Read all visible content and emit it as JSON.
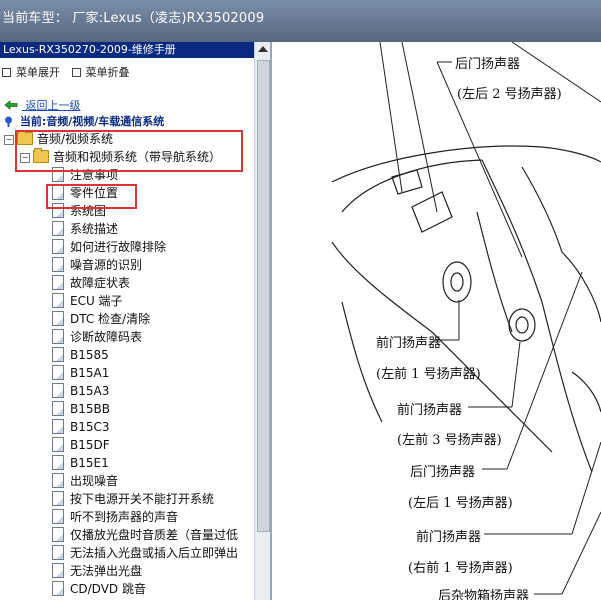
{
  "titlebar": {
    "text": "当前车型： 厂家:Lexus（凌志)RX3502009"
  },
  "left": {
    "header": "Lexus-RX350270-2009-维修手册",
    "menu_expand": "菜单展开",
    "menu_collapse": "菜单折叠",
    "back_link": "返回上一级",
    "current": "当前:音频/视频/车载通信系统",
    "tree": {
      "root": "音频/视频系统",
      "child": "音频和视频系统（带导航系统）",
      "items": [
        "注意事项",
        "零件位置",
        "系统图",
        "系统描述",
        "如何进行故障排除",
        "噪音源的识别",
        "故障症状表",
        "ECU 端子",
        "DTC 检查/清除",
        "诊断故障码表",
        "B1585",
        "B15A1",
        "B15A3",
        "B15BB",
        "B15C3",
        "B15DF",
        "B15E1",
        "出现噪音",
        "按下电源开关不能打开系统",
        "听不到扬声器的声音",
        "仅播放光盘时音质差（音量过低",
        "无法插入光盘或插入后立即弹出",
        "无法弹出光盘",
        "CD/DVD 跳音"
      ]
    }
  },
  "diagram": {
    "labels": [
      "后门扬声器",
      "(左后 2 号扬声器)",
      "前门扬声器",
      "(左前 1 号扬声器)",
      "前门扬声器",
      "(左前 3 号扬声器)",
      "后门扬声器",
      "(左后 1 号扬声器)",
      "前门扬声器",
      "(右前 1 号扬声器)",
      "后杂物箱扬声器"
    ]
  }
}
